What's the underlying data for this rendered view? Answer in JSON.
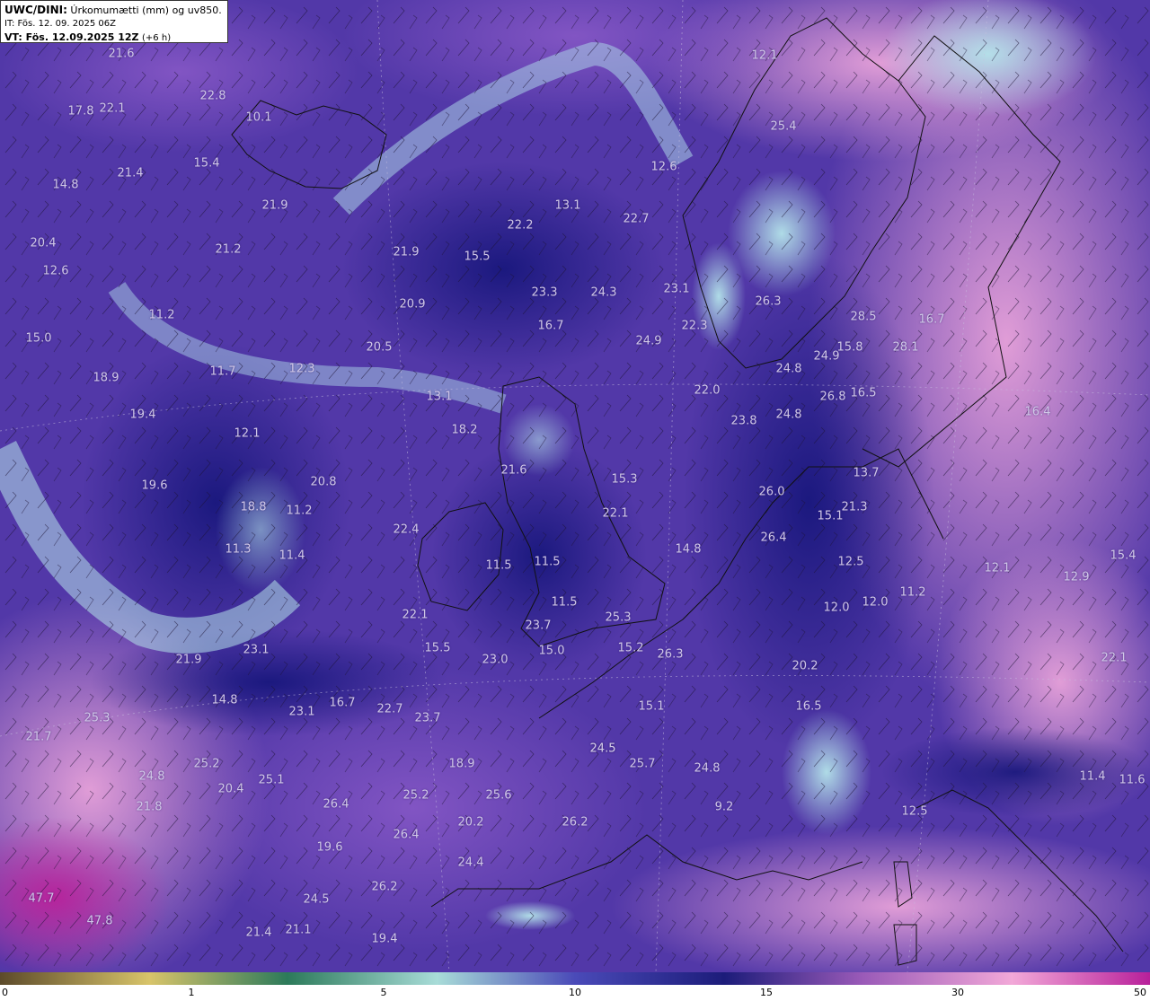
{
  "header": {
    "model": "UWC/DINI:",
    "field": "Úrkomumætti (mm) og uv850.",
    "init_time": "IT: Fös. 12. 09. 2025 06Z",
    "valid_label": "VT: Fös. 12.09.2025 12Z",
    "valid_offset": "(+6 h)"
  },
  "colors": {
    "land_outline": "#111111",
    "label_text": "#cfc7e6",
    "scale": [
      "#5c4a2a",
      "#d8c46a",
      "#2c7a5a",
      "#a8dcd8",
      "#4a4ab8",
      "#1c1c7a",
      "#9a5ab8",
      "#f2a8d8",
      "#b8209a"
    ]
  },
  "value_labels": [
    "21.6",
    "22.8",
    "17.8",
    "22.1",
    "10.1",
    "15.4",
    "21.4",
    "14.8",
    "21.9",
    "20.4",
    "21.2",
    "12.6",
    "15.0",
    "11.2",
    "18.9",
    "11.7",
    "12.3",
    "19.4",
    "12.1",
    "19.6",
    "18.8",
    "11.2",
    "20.8",
    "11.3",
    "11.4",
    "22.1",
    "23.1",
    "21.9",
    "14.8",
    "25.3",
    "21.7",
    "25.2",
    "24.8",
    "20.4",
    "25.1",
    "21.8",
    "26.4",
    "19.6",
    "24.5",
    "21.1",
    "21.4",
    "47.7",
    "47.8",
    "19.4",
    "26.2",
    "24.4",
    "26.4",
    "20.2",
    "25.2",
    "25.6",
    "26.2",
    "18.9",
    "23.7",
    "22.7",
    "16.7",
    "23.1",
    "24.5",
    "15.5",
    "23.0",
    "15.0",
    "23.7",
    "11.5",
    "11.5",
    "11.5",
    "22.4",
    "21.6",
    "18.2",
    "13.1",
    "20.5",
    "20.9",
    "21.9",
    "15.5",
    "22.2",
    "23.3",
    "24.3",
    "16.7",
    "13.1",
    "12.6",
    "22.7",
    "24.9",
    "23.1",
    "22.3",
    "22.0",
    "23.8",
    "24.8",
    "24.8",
    "26.3",
    "26.8",
    "24.9",
    "15.8",
    "28.5",
    "16.5",
    "28.1",
    "16.7",
    "12.1",
    "25.4",
    "15.3",
    "22.1",
    "25.3",
    "15.2",
    "26.3",
    "15.1",
    "14.8",
    "24.5",
    "25.7",
    "24.8",
    "26.0",
    "26.4",
    "15.1",
    "21.3",
    "13.7",
    "12.5",
    "12.0",
    "12.0",
    "11.2",
    "16.5",
    "20.2",
    "9.2",
    "12.5",
    "12.1",
    "12.9",
    "15.4",
    "16.4",
    "22.1",
    "11.4",
    "11.6"
  ],
  "colorbar": {
    "ticks": [
      "0",
      "1",
      "5",
      "10",
      "15",
      "30",
      "50"
    ]
  }
}
